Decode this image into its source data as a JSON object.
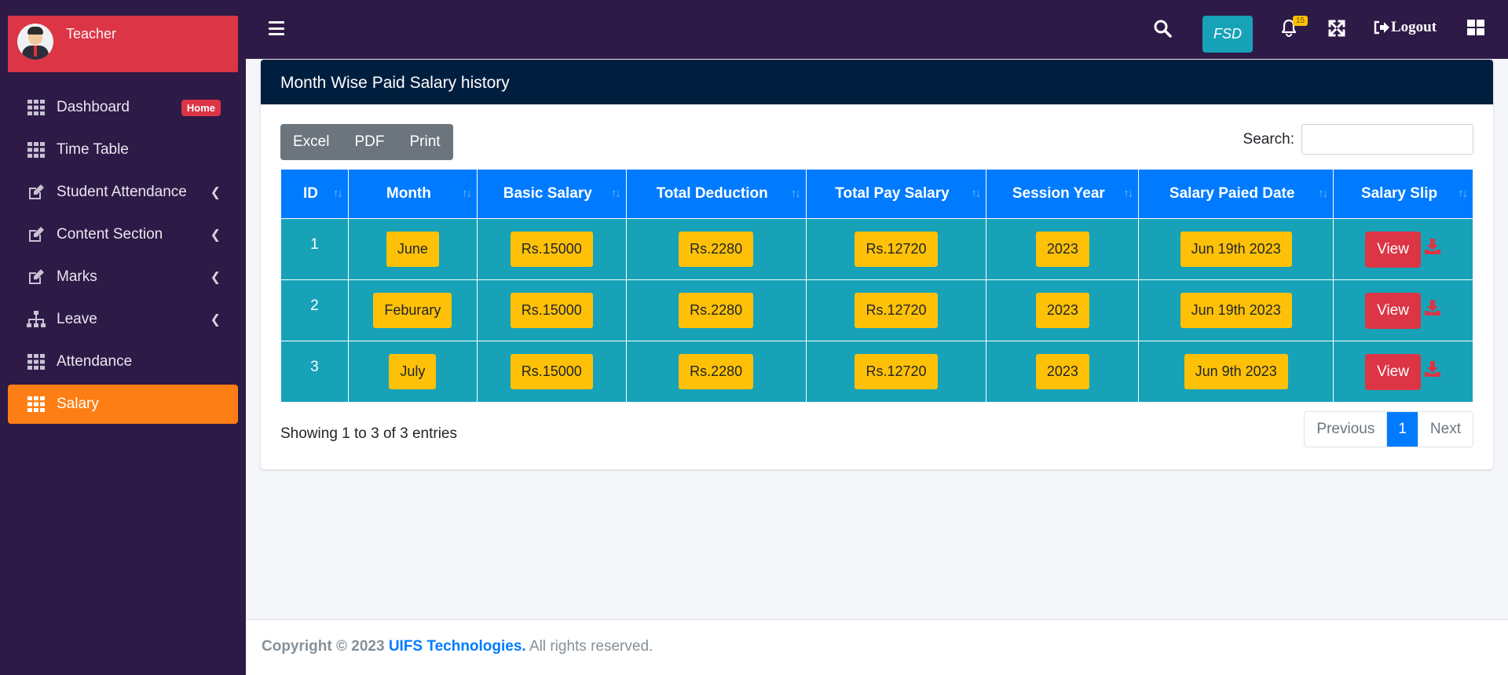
{
  "sidebar": {
    "profile_name": "Teacher",
    "items": [
      {
        "label": "Dashboard",
        "badge": "Home",
        "icon": "grid-icon"
      },
      {
        "label": "Time Table",
        "icon": "grid-icon"
      },
      {
        "label": "Student Attendance",
        "icon": "edit-icon",
        "expandable": true
      },
      {
        "label": "Content Section",
        "icon": "edit-icon",
        "expandable": true
      },
      {
        "label": "Marks",
        "icon": "edit-icon",
        "expandable": true
      },
      {
        "label": "Leave",
        "icon": "sitemap-icon",
        "expandable": true
      },
      {
        "label": "Attendance",
        "icon": "grid-icon"
      },
      {
        "label": "Salary",
        "icon": "grid-icon",
        "active": true
      }
    ]
  },
  "topbar": {
    "fsd_label": "FSD",
    "notification_count": "15",
    "logout_label": "Logout"
  },
  "card": {
    "title": "Month Wise Paid Salary history",
    "buttons": {
      "excel": "Excel",
      "pdf": "PDF",
      "print": "Print"
    },
    "search_label": "Search:",
    "search_value": ""
  },
  "table": {
    "headers": [
      "ID",
      "Month",
      "Basic Salary",
      "Total Deduction",
      "Total Pay Salary",
      "Session Year",
      "Salary Paied Date",
      "Salary Slip"
    ],
    "rows": [
      {
        "id": "1",
        "month": "June",
        "basic": "Rs.15000",
        "deduction": "Rs.2280",
        "pay": "Rs.12720",
        "session": "2023",
        "date": "Jun 19th 2023",
        "action": "View"
      },
      {
        "id": "2",
        "month": "Feburary",
        "basic": "Rs.15000",
        "deduction": "Rs.2280",
        "pay": "Rs.12720",
        "session": "2023",
        "date": "Jun 19th 2023",
        "action": "View"
      },
      {
        "id": "3",
        "month": "July",
        "basic": "Rs.15000",
        "deduction": "Rs.2280",
        "pay": "Rs.12720",
        "session": "2023",
        "date": "Jun 9th 2023",
        "action": "View"
      }
    ]
  },
  "info": "Showing 1 to 3 of 3 entries",
  "pagination": {
    "previous": "Previous",
    "current": "1",
    "next": "Next"
  },
  "footer": {
    "prefix": "Copyright © 2023 ",
    "brand": "UIFS Technologies.",
    "suffix": " All rights reserved."
  },
  "colors": {
    "sidebar_bg": "#2e1a47",
    "active_item": "#fd7e14",
    "profile_bg": "#dc3545",
    "card_header": "#001f3f",
    "table_header": "#007bff",
    "table_cell": "#17a2b8",
    "pill": "#ffc107",
    "view_button": "#dc3545"
  }
}
